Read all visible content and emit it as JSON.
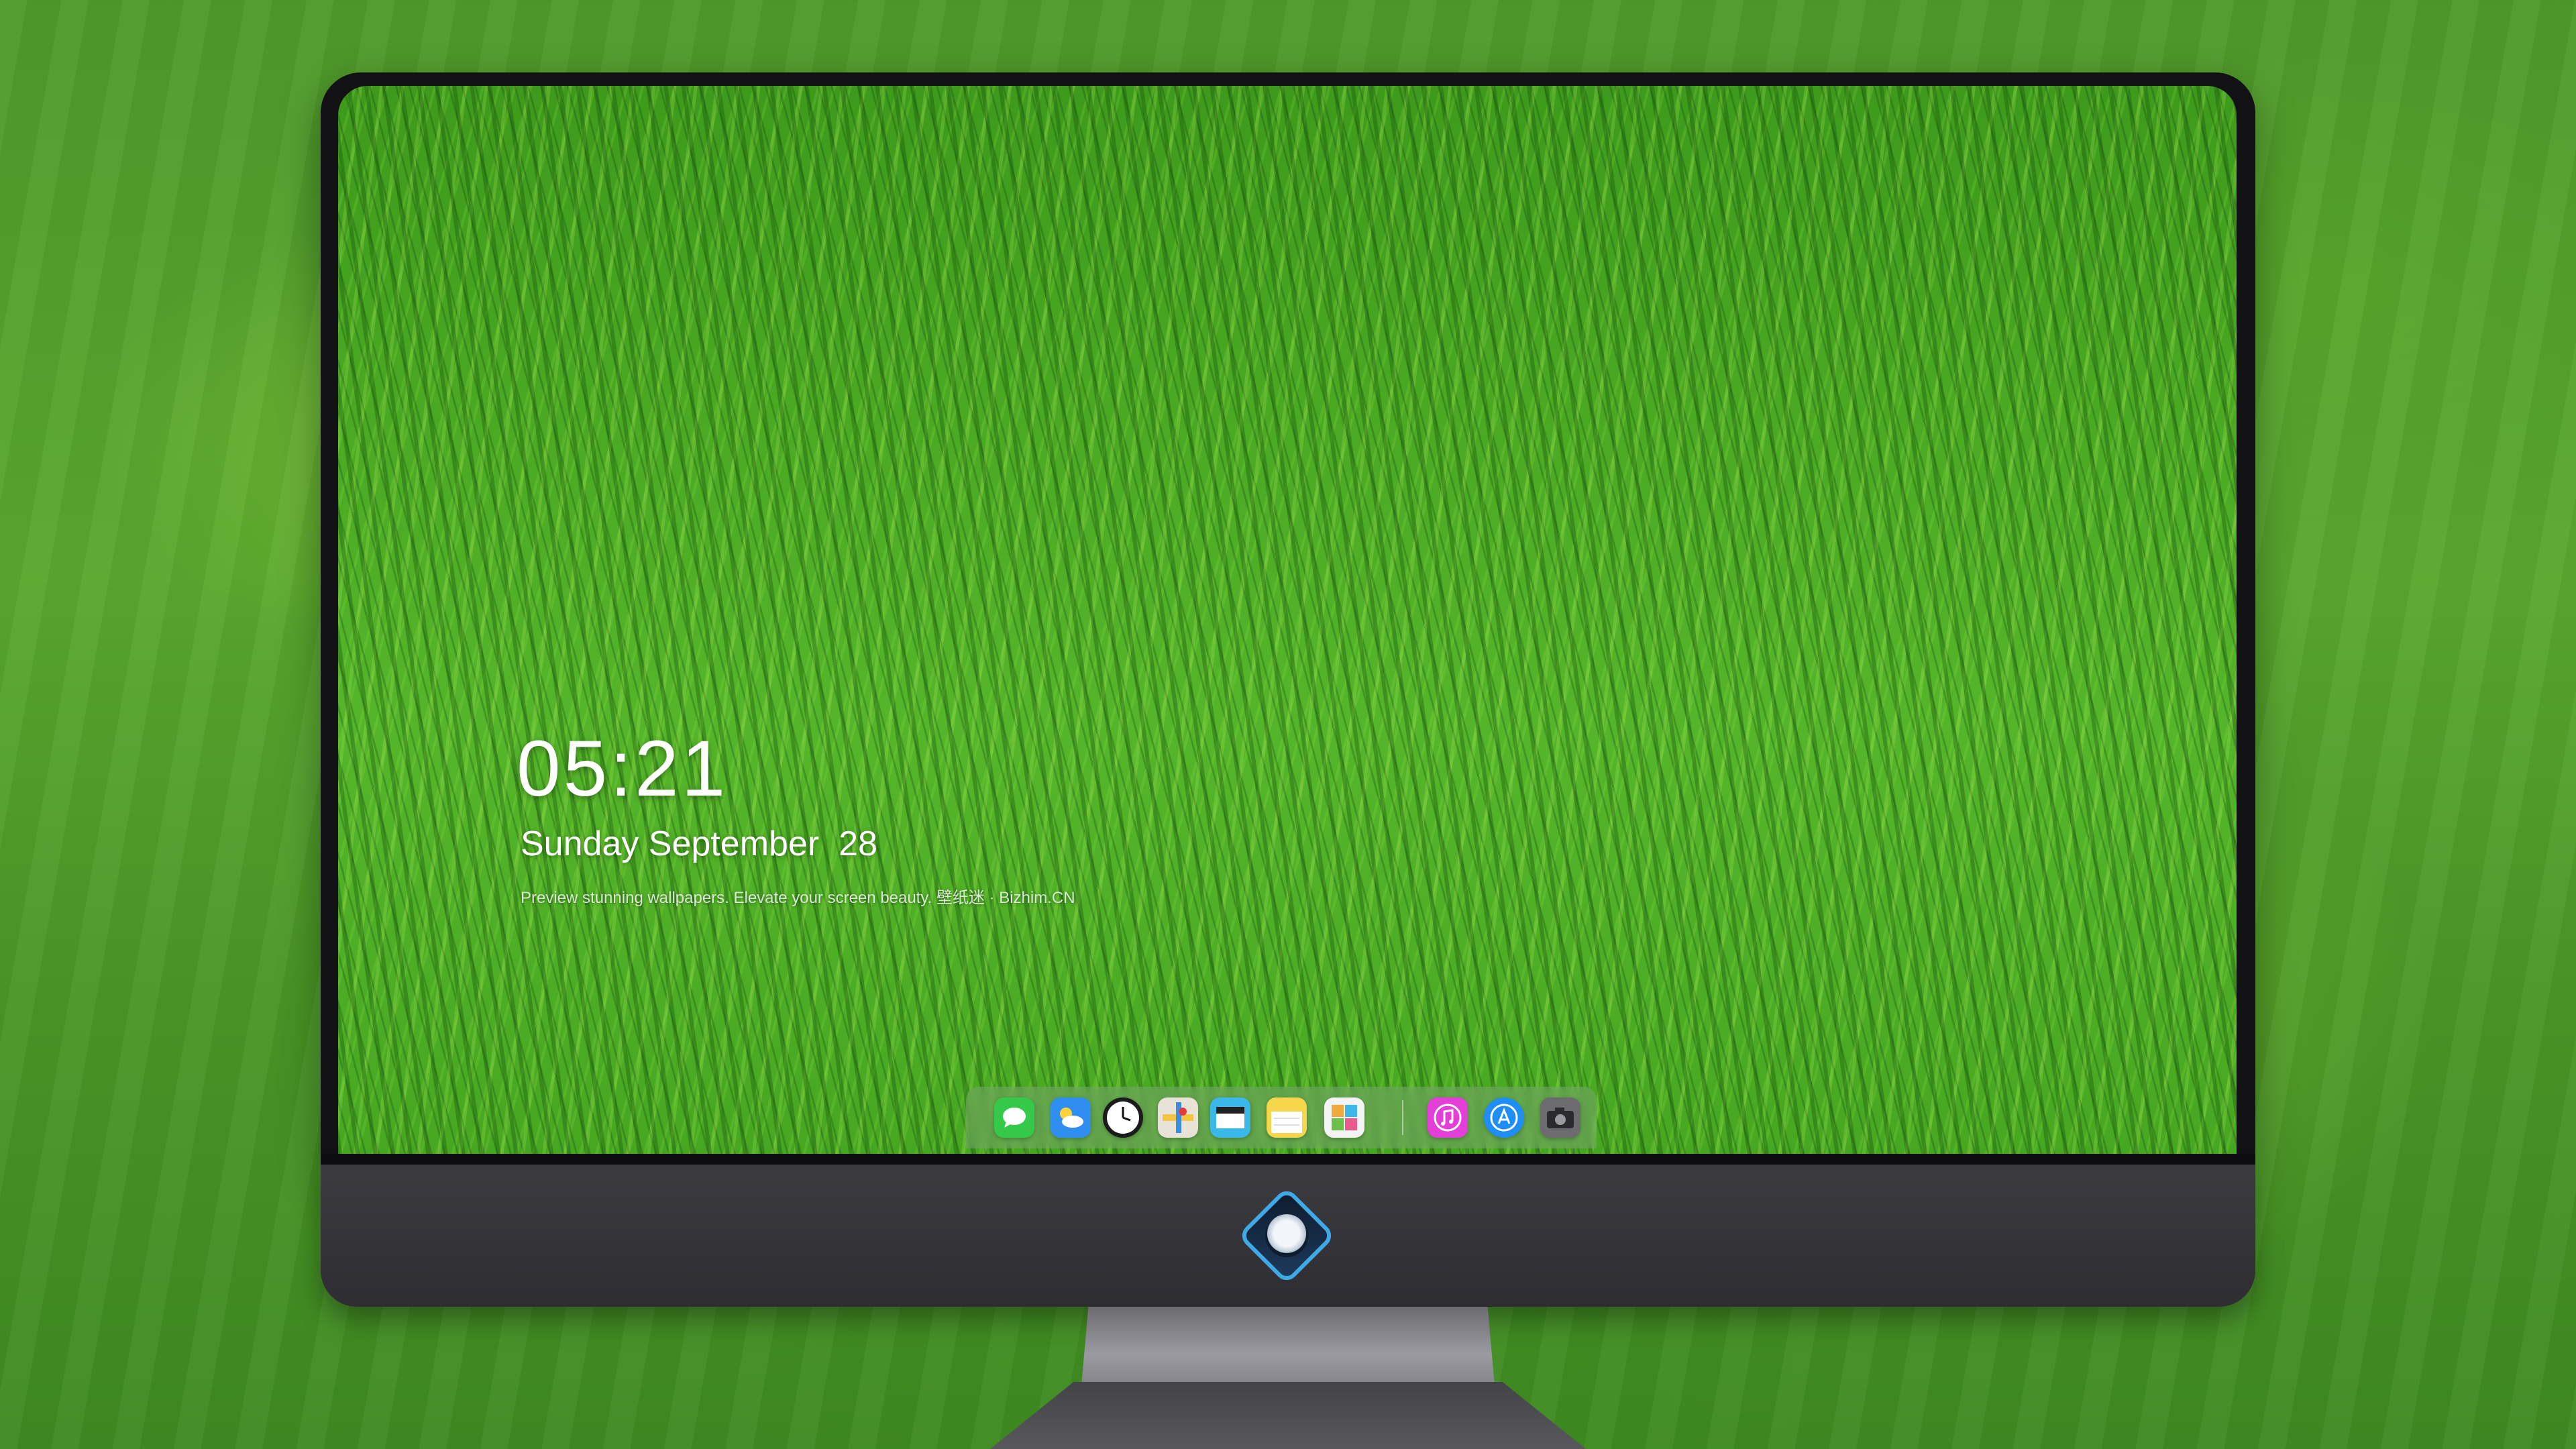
{
  "lockscreen": {
    "time": "05:21",
    "date": "Sunday September  28",
    "tagline": "Preview stunning wallpapers. Elevate your screen beauty. 壁纸迷 · Bizhim.CN"
  },
  "dock": {
    "items": [
      {
        "name": "messages-icon",
        "color": "#35c94a"
      },
      {
        "name": "weather-icon",
        "color": "#2f8ff0"
      },
      {
        "name": "clock-icon",
        "color": "#1b1b1b"
      },
      {
        "name": "maps-icon",
        "color": "#e8e3d6"
      },
      {
        "name": "video-icon",
        "color": "#3ab8e8"
      },
      {
        "name": "notes-icon",
        "color": "#f6d64a"
      },
      {
        "name": "photos-icon",
        "color": "#f3f3f3"
      },
      {
        "name": "itunes-icon",
        "color": "#e43ed8"
      },
      {
        "name": "app-store-icon",
        "color": "#1e8df5"
      },
      {
        "name": "camera-icon",
        "color": "#6c6c70"
      }
    ]
  }
}
